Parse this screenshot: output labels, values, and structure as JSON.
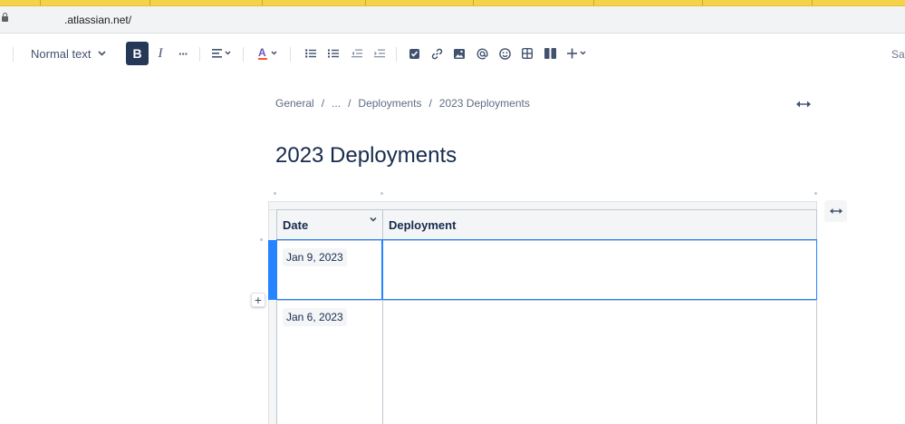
{
  "browser": {
    "url": ".atlassian.net/"
  },
  "toolbar": {
    "text_style": "Normal text",
    "bold_label": "B",
    "italic_label": "I",
    "more_label": "···",
    "save_label": "Sav",
    "colors": {
      "accent_active": "#253858",
      "text_color_underline": "#ff5630",
      "text_color_letter": "#6554c0"
    },
    "icons": [
      "chevron-down-icon",
      "align-left-icon",
      "text-color-icon",
      "bullet-list-icon",
      "numbered-list-icon",
      "outdent-icon",
      "indent-icon",
      "checkbox-icon",
      "link-icon",
      "image-icon",
      "mention-icon",
      "emoji-icon",
      "table-icon",
      "layout-icon",
      "plus-icon"
    ]
  },
  "breadcrumb": {
    "items": [
      "General",
      "...",
      "Deployments",
      "2023 Deployments"
    ],
    "separator": "/"
  },
  "page": {
    "title": "2023 Deployments"
  },
  "table": {
    "headers": [
      "Date",
      "Deployment"
    ],
    "rows": [
      {
        "date": "Jan 9, 2023",
        "deployment": ""
      },
      {
        "date": "Jan 6, 2023",
        "deployment": ""
      }
    ],
    "colors": {
      "selection": "#2684ff",
      "border": "#c1c7d0",
      "header_bg": "#f4f5f7"
    }
  },
  "insert_row": {
    "label": "+"
  }
}
